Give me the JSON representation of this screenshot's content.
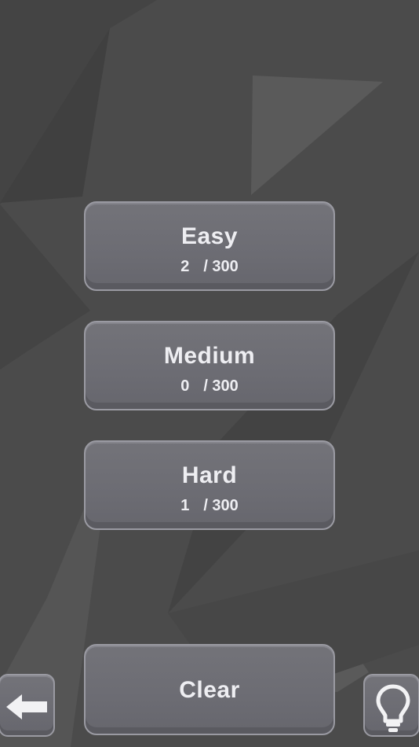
{
  "levels": [
    {
      "title": "Easy",
      "solved": "2",
      "total": "/ 300"
    },
    {
      "title": "Medium",
      "solved": "0",
      "total": "/ 300"
    },
    {
      "title": "Hard",
      "solved": "1",
      "total": "/ 300"
    }
  ],
  "clear_label": "Clear",
  "icons": {
    "back": "arrow-left-icon",
    "hint": "lightbulb-icon"
  },
  "colors": {
    "background": "#4b4b4b",
    "button": "#6c6c73",
    "button_border": "#9a9aa2",
    "text": "#eeeef2"
  }
}
